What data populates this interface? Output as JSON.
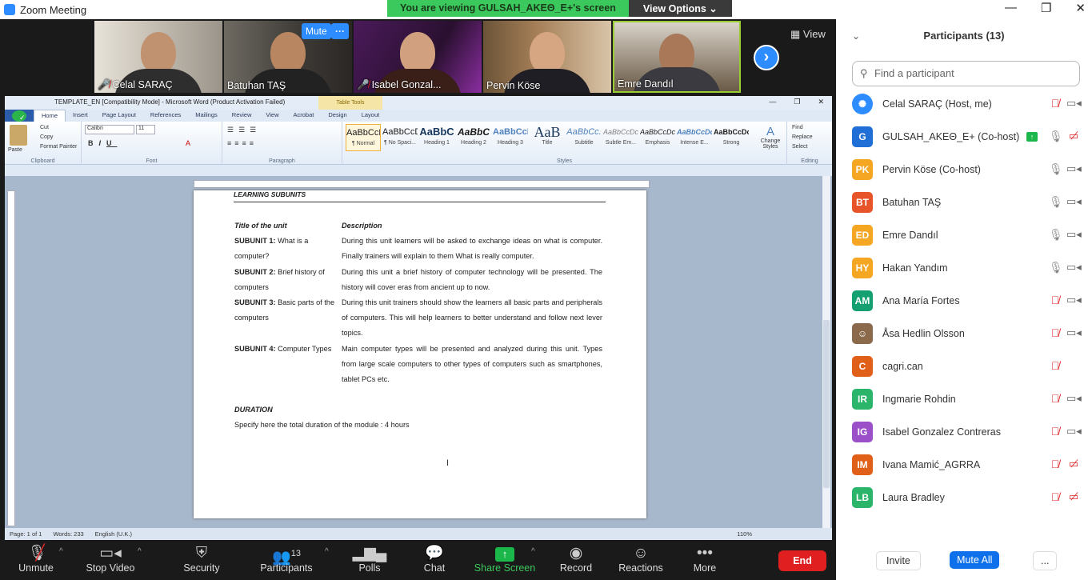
{
  "window": {
    "title": "Zoom Meeting"
  },
  "banner": {
    "viewing": "You are viewing GULSAH_AKEΘ_E+'s screen",
    "view_options": "View Options"
  },
  "window_controls": {
    "min": "—",
    "max": "❐",
    "close": "✕"
  },
  "thumbnails": [
    {
      "name": "Celal SARAÇ",
      "muted": true
    },
    {
      "name": "Batuhan TAŞ",
      "muted": false
    },
    {
      "name": "Isabel Gonzal...",
      "muted": true
    },
    {
      "name": "Pervin Köse",
      "muted": false
    },
    {
      "name": "Emre Dandıl",
      "muted": false
    }
  ],
  "thumb_controls": {
    "mute": "Mute",
    "more": "···",
    "view": "View"
  },
  "word": {
    "title": "TEMPLATE_EN [Compatibility Mode] - Microsoft Word (Product Activation Failed)",
    "table_tools": "Table Tools",
    "tabs": [
      "Home",
      "Insert",
      "Page Layout",
      "References",
      "Mailings",
      "Review",
      "View",
      "Acrobat",
      "Design",
      "Layout"
    ],
    "file_tab": "",
    "clipboard": {
      "paste": "Paste",
      "cut": "Cut",
      "copy": "Copy",
      "format_painter": "Format Painter",
      "label": "Clipboard"
    },
    "font": {
      "name": "Calibri",
      "size": "11",
      "label": "Font"
    },
    "paragraph": {
      "label": "Paragraph"
    },
    "styles": [
      {
        "preview": "AaBbCcDc",
        "name": "¶ Normal"
      },
      {
        "preview": "AaBbCcDc",
        "name": "¶ No Spaci..."
      },
      {
        "preview": "AaBbC",
        "name": "Heading 1"
      },
      {
        "preview": "AaBbC",
        "name": "Heading 2"
      },
      {
        "preview": "AaBbCcI",
        "name": "Heading 3"
      },
      {
        "preview": "AaB",
        "name": "Title"
      },
      {
        "preview": "AaBbCc.",
        "name": "Subtitle"
      },
      {
        "preview": "AaBbCcDc",
        "name": "Subtle Em..."
      },
      {
        "preview": "AaBbCcDc",
        "name": "Emphasis"
      },
      {
        "preview": "AaBbCcDc",
        "name": "Intense E..."
      },
      {
        "preview": "AaBbCcDc",
        "name": "Strong"
      }
    ],
    "styles_label": "Styles",
    "change_styles": "Change Styles",
    "editing": {
      "find": "Find",
      "replace": "Replace",
      "select": "Select",
      "label": "Editing"
    },
    "doc": {
      "header": "LEARNING SUBUNITS",
      "col_title": "Title of the unit",
      "col_desc": "Description",
      "rows": [
        {
          "bold": "SUBUNIT 1:",
          "title": " What is a computer?",
          "desc": "During this unit learners will be asked to exchange ideas on what is computer. Finally trainers will explain to them What is really computer."
        },
        {
          "bold": "SUBUNIT 2:",
          "title": " Brief history of computers",
          "desc": "During this unit a brief history of computer technology will be presented. The history will cover eras from ancient up to now."
        },
        {
          "bold": "SUBUNIT 3:",
          "title": " Basic parts of the computers",
          "desc": "During this unit trainers should show the learners all basic parts and peripherals of computers. This will help learners to better understand and follow next lever topics."
        },
        {
          "bold": "SUBUNIT 4:",
          "title": " Computer Types",
          "desc": "Main computer types will be presented and analyzed during this unit. Types from large scale computers to other types of computers such as smartphones, tablet PCs etc."
        }
      ],
      "duration_h": "DURATION",
      "duration_t": "Specify here the total duration of the module : 4 hours"
    },
    "status": {
      "page": "Page: 1 of 1",
      "words": "Words: 233",
      "lang": "English (U.K.)",
      "zoom": "110%"
    }
  },
  "toolbar": {
    "unmute": "Unmute",
    "stop_video": "Stop Video",
    "security": "Security",
    "participants": "Participants",
    "participants_count": "13",
    "polls": "Polls",
    "chat": "Chat",
    "share": "Share Screen",
    "record": "Record",
    "reactions": "Reactions",
    "more": "More",
    "end": "End"
  },
  "panel": {
    "title": "Participants (13)",
    "search_placeholder": "Find a participant",
    "participants": [
      {
        "initials": "",
        "name": "Celal SARAÇ (Host, me)",
        "color": "#2d8cff",
        "mic": "muted",
        "cam": "on"
      },
      {
        "initials": "G",
        "name": "GULSAH_AKEΘ_E+ (Co-host)",
        "color": "#1f6fd6",
        "mic": "on",
        "cam": "off",
        "sharing": true
      },
      {
        "initials": "PK",
        "name": "Pervin Köse (Co-host)",
        "color": "#f5a623",
        "mic": "on",
        "cam": "on"
      },
      {
        "initials": "BT",
        "name": "Batuhan TAŞ",
        "color": "#e8542a",
        "mic": "on",
        "cam": "on"
      },
      {
        "initials": "ED",
        "name": "Emre Dandıl",
        "color": "#f5a623",
        "mic": "on",
        "cam": "on"
      },
      {
        "initials": "HY",
        "name": "Hakan Yandım",
        "color": "#f5a623",
        "mic": "on",
        "cam": "on"
      },
      {
        "initials": "AM",
        "name": "Ana María Fortes",
        "color": "#14a070",
        "mic": "muted",
        "cam": "on"
      },
      {
        "initials": "",
        "name": "Åsa Hedlin Olsson",
        "color": "#8a6a4a",
        "mic": "muted",
        "cam": "on"
      },
      {
        "initials": "C",
        "name": "cagri.can",
        "color": "#e0601a",
        "mic": "muted",
        "cam": "none"
      },
      {
        "initials": "IR",
        "name": "Ingmarie Rohdin",
        "color": "#2bb56a",
        "mic": "muted",
        "cam": "on"
      },
      {
        "initials": "IG",
        "name": "Isabel Gonzalez Contreras",
        "color": "#9b4fc8",
        "mic": "muted",
        "cam": "on"
      },
      {
        "initials": "IM",
        "name": "Ivana Mamić_AGRRA",
        "color": "#e0601a",
        "mic": "muted",
        "cam": "off"
      },
      {
        "initials": "LB",
        "name": "Laura Bradley",
        "color": "#2bb56a",
        "mic": "muted",
        "cam": "off"
      }
    ],
    "invite": "Invite",
    "mute_all": "Mute All",
    "more": "..."
  }
}
